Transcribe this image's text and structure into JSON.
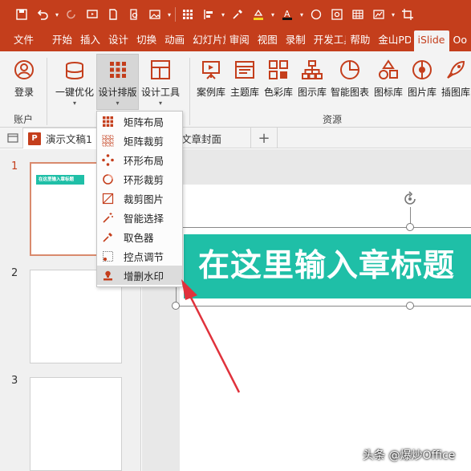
{
  "tabs": [
    "文件",
    "开始",
    "插入",
    "设计",
    "切换",
    "动画",
    "幻灯片放",
    "审阅",
    "视图",
    "录制",
    "开发工具",
    "帮助",
    "金山PDF",
    "iSlide",
    "Oo"
  ],
  "active_tab": "iSlide",
  "ribbon": {
    "login": "登录",
    "optimize": "一键优化",
    "layout": "设计排版",
    "tools": "设计工具",
    "case_lib": "案例库",
    "theme_lib": "主题库",
    "color_lib": "色彩库",
    "diagram_lib": "图示库",
    "smart_chart": "智能图表",
    "icon_lib": "图标库",
    "image_lib": "图片库",
    "illus_lib": "插图库",
    "group_account": "账户",
    "group_resources": "资源"
  },
  "doc_tabs": {
    "active": "演示文稿1",
    "other": "文章封面",
    "add": "+"
  },
  "menu": {
    "items": [
      "矩阵布局",
      "矩阵裁剪",
      "环形布局",
      "环形裁剪",
      "裁剪图片",
      "智能选择",
      "取色器",
      "控点调节",
      "增删水印"
    ],
    "highlighted": "增删水印"
  },
  "slides": {
    "numbers": [
      "1",
      "2",
      "3"
    ],
    "thumb_title": "在这里输入章标题"
  },
  "slide": {
    "title": "在这里输入章标题"
  },
  "watermark": "头条 @爆炒Office",
  "colors": {
    "brand": "#c43e1c",
    "teal": "#1fbfa7",
    "arrow": "#e0323c"
  }
}
